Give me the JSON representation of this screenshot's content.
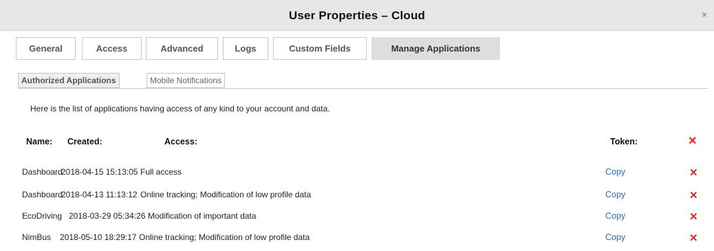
{
  "window": {
    "title": "User Properties – Cloud",
    "close_icon": "×"
  },
  "tabs": [
    {
      "label": "General",
      "active": false
    },
    {
      "label": "Access",
      "active": false
    },
    {
      "label": "Advanced",
      "active": false
    },
    {
      "label": "Logs",
      "active": false
    },
    {
      "label": "Custom Fields",
      "active": false
    },
    {
      "label": "Manage Applications",
      "active": true
    }
  ],
  "subtabs": [
    {
      "label": "Authorized Applications",
      "active": true
    },
    {
      "label": "Mobile Notifications",
      "active": false
    }
  ],
  "intro_text": "Here is the list of applications having access of any kind to your account and data.",
  "table": {
    "headers": {
      "name": "Name:",
      "created": "Created:",
      "access": "Access:",
      "token": "Token:"
    },
    "revoke_all_icon": "✕",
    "rows": [
      {
        "name": "Dashboard",
        "created": "2018-04-15 15:13:05",
        "access": "Full access",
        "copy_label": "Copy",
        "delete_icon": "✕"
      },
      {
        "name": "Dashboard",
        "created": "2018-04-13 11:13:12",
        "access": "Online tracking; Modification of low profile data",
        "copy_label": "Copy",
        "delete_icon": "✕"
      },
      {
        "name": "EcoDriving",
        "created": "2018-03-29 05:34:26",
        "access": "Modification of important data",
        "copy_label": "Copy",
        "delete_icon": "✕"
      },
      {
        "name": "NimBus",
        "created": "2018-05-10 18:29:17",
        "access": "Online tracking; Modification of low profile data",
        "copy_label": "Copy",
        "delete_icon": "✕"
      }
    ]
  },
  "colors": {
    "link": "#2a6ebb",
    "delete": "#e0262b",
    "titlebar": "#e7e7e7",
    "active_tab": "#dedede"
  }
}
